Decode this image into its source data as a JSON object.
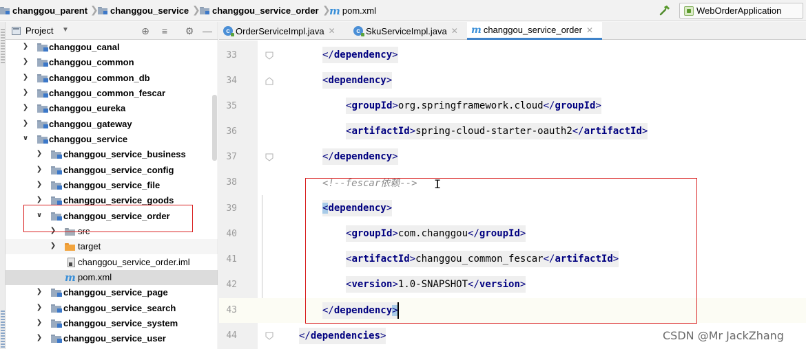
{
  "navbar": {
    "crumbs": [
      "changgou_parent",
      "changgou_service",
      "changgou_service_order",
      "pom.xml"
    ],
    "run_config": "WebOrderApplication"
  },
  "project": {
    "title": "Project",
    "tree": [
      {
        "label": "changgou_canal",
        "type": "module",
        "state": "collapsed"
      },
      {
        "label": "changgou_common",
        "type": "module",
        "state": "collapsed"
      },
      {
        "label": "changgou_common_db",
        "type": "module",
        "state": "collapsed"
      },
      {
        "label": "changgou_common_fescar",
        "type": "module",
        "state": "collapsed"
      },
      {
        "label": "changgou_eureka",
        "type": "module",
        "state": "collapsed"
      },
      {
        "label": "changgou_gateway",
        "type": "module",
        "state": "collapsed"
      },
      {
        "label": "changgou_service",
        "type": "module",
        "state": "expanded"
      },
      {
        "label": "changgou_service_business",
        "type": "module",
        "state": "collapsed"
      },
      {
        "label": "changgou_service_config",
        "type": "module",
        "state": "collapsed"
      },
      {
        "label": "changgou_service_file",
        "type": "module",
        "state": "collapsed"
      },
      {
        "label": "changgou_service_goods",
        "type": "module",
        "state": "collapsed"
      },
      {
        "label": "changgou_service_order",
        "type": "module",
        "state": "expanded"
      },
      {
        "label": "src",
        "type": "folder",
        "state": "collapsed"
      },
      {
        "label": "target",
        "type": "folder-excluded",
        "state": "collapsed"
      },
      {
        "label": "changgou_service_order.iml",
        "type": "iml"
      },
      {
        "label": "pom.xml",
        "type": "pom",
        "selected": true
      },
      {
        "label": "changgou_service_page",
        "type": "module",
        "state": "collapsed"
      },
      {
        "label": "changgou_service_search",
        "type": "module",
        "state": "collapsed"
      },
      {
        "label": "changgou_service_system",
        "type": "module",
        "state": "collapsed"
      },
      {
        "label": "changgou_service_user",
        "type": "module",
        "state": "collapsed"
      }
    ]
  },
  "tabs": [
    {
      "label": "OrderServiceImpl.java",
      "icon": "java-class-icon",
      "active": false
    },
    {
      "label": "SkuServiceImpl.java",
      "icon": "java-class-icon",
      "active": false
    },
    {
      "label": "changgou_service_order",
      "icon": "maven-icon",
      "active": true
    }
  ],
  "editor": {
    "lines": [
      {
        "num": "33",
        "open": "</",
        "tag": "dependency",
        "close": ">"
      },
      {
        "num": "34",
        "open": "<",
        "tag": "dependency",
        "close": ">"
      },
      {
        "num": "35",
        "tag": "groupId",
        "text": "org.springframework.cloud"
      },
      {
        "num": "36",
        "tag": "artifactId",
        "text": "spring-cloud-starter-oauth2"
      },
      {
        "num": "37",
        "open": "</",
        "tag": "dependency",
        "close": ">"
      },
      {
        "num": "38",
        "comment": "<!--fescar依赖-->"
      },
      {
        "num": "39",
        "open": "<",
        "tag": "dependency",
        "close": ">"
      },
      {
        "num": "40",
        "tag": "groupId",
        "text": "com.changgou"
      },
      {
        "num": "41",
        "tag": "artifactId",
        "text": "changgou_common_fescar"
      },
      {
        "num": "42",
        "tag": "version",
        "text": "1.0-SNAPSHOT"
      },
      {
        "num": "43",
        "open": "</",
        "tag": "dependency",
        "close": ">"
      },
      {
        "num": "44",
        "open": "</",
        "tag": "dependencies",
        "close": ">"
      }
    ]
  },
  "watermark": "CSDN @Mr JackZhang",
  "colors": {
    "tag": "#000080",
    "highlight_box": "#d81e1e",
    "selection": "#dcdcdc",
    "accent": "#4083c9"
  }
}
